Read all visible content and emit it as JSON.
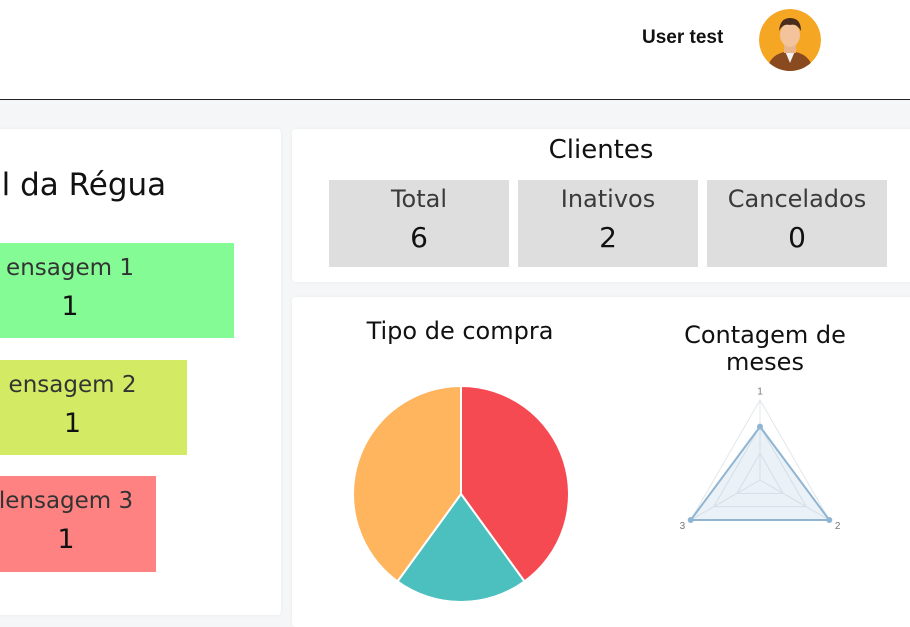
{
  "header": {
    "user_name": "User test"
  },
  "perfil": {
    "title": "il da Régua",
    "messages": [
      {
        "label": "ensagem 1",
        "value": "1",
        "color": "#84fb95"
      },
      {
        "label": "ensagem 2",
        "value": "1",
        "color": "#d2ea64"
      },
      {
        "label": "lensagem 3",
        "value": "1",
        "color": "#fe8282"
      }
    ]
  },
  "clientes": {
    "title": "Clientes",
    "kpis": [
      {
        "label": "Total",
        "value": "6"
      },
      {
        "label": "Inativos",
        "value": "2"
      },
      {
        "label": "Cancelados",
        "value": "0"
      }
    ]
  },
  "chart_data": [
    {
      "type": "pie",
      "title": "Tipo de compra",
      "slices": [
        {
          "value": 40,
          "color": "#f64a52"
        },
        {
          "value": 20,
          "color": "#4bc0be"
        },
        {
          "value": 40,
          "color": "#ffb45e"
        }
      ]
    },
    {
      "type": "radar",
      "title": "Contagem de meses",
      "axes": [
        "1",
        "2",
        "3"
      ],
      "max": 3,
      "values": [
        2,
        3,
        3
      ],
      "color": "#8fb5d3"
    }
  ]
}
